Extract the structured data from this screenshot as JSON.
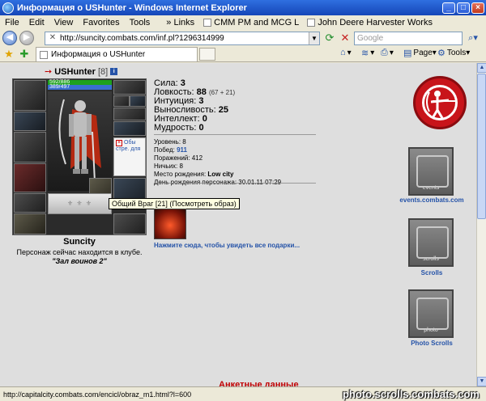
{
  "window": {
    "title": "Информация о USHunter - Windows Internet Explorer"
  },
  "menu": {
    "file": "File",
    "edit": "Edit",
    "view": "View",
    "favorites": "Favorites",
    "tools": "Tools",
    "links_label": "Links",
    "link1": "CMM PM and MCG L",
    "link2": "John Deere Harvester Works"
  },
  "address": {
    "url": "http://suncity.combats.com/inf.pl?1296314999",
    "search_placeholder": "Google"
  },
  "tab": {
    "label": "Информация о USHunter"
  },
  "commands": {
    "page": "Page",
    "tools": "Tools"
  },
  "character": {
    "name": "USHunter",
    "level": "[8]",
    "hp": "592/886",
    "mp": "389/497",
    "city": "Suncity",
    "club_line": "Персонаж сейчас находится в клубе.",
    "club_room": "\"Зал воинов 2\""
  },
  "infocard": {
    "text": "Обы стре. для"
  },
  "tooltip": {
    "text": "Общий Враг [21] (Посмотреть образ)"
  },
  "stats": {
    "strength_label": "Сила:",
    "strength": "3",
    "agility_label": "Ловкость:",
    "agility": "88",
    "agility_extra": "(67 + 21)",
    "intuition_label": "Интуиция:",
    "intuition": "3",
    "endurance_label": "Выносливость:",
    "endurance": "25",
    "intellect_label": "Интеллект:",
    "intellect": "0",
    "wisdom_label": "Мудрость:",
    "wisdom": "0"
  },
  "details": {
    "level_label": "Уровень:",
    "level": "8",
    "wins_label": "Побед:",
    "wins": "911",
    "losses_label": "Поражений:",
    "losses": "412",
    "draws_label": "Ничьих:",
    "draws": "8",
    "birthplace_label": "Место рождения:",
    "birthplace": "Low city",
    "birthday_label": "День рождения персонажа:",
    "birthday": "30.01.11 07:29"
  },
  "gifts": {
    "link": "Нажмите сюда, чтобы увидеть все подарки..."
  },
  "side_banners": {
    "events_label": "events",
    "events_caption": "events.combats.com",
    "scrolls_label": "scrolls",
    "scrolls_caption": "Scrolls",
    "photo_label": "photo",
    "photo_caption": "Photo Scrolls"
  },
  "bottom": {
    "heading": "Анкетные данные"
  },
  "status": {
    "text": "http://capitalcity.combats.com/encicl/obraz_m1.html?l=600",
    "watermark": "photo.scrolls.combats.com"
  },
  "colors": {
    "link_blue": "#2553a8",
    "emblem_red": "#c8141a",
    "heading_red": "#c00000"
  }
}
